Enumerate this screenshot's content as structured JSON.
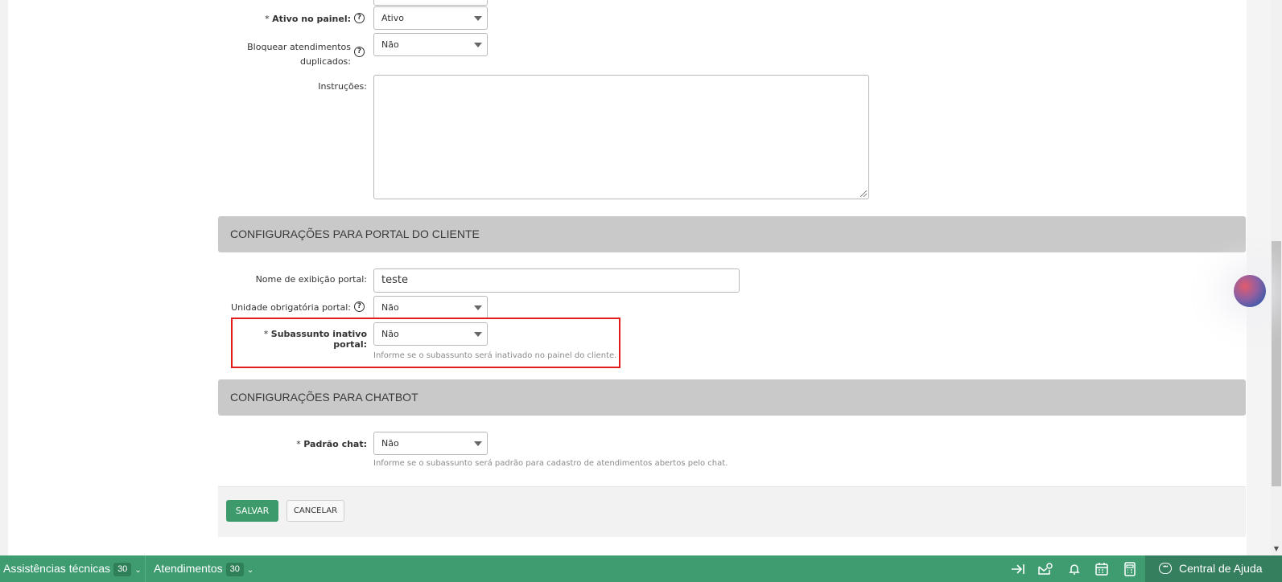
{
  "form": {
    "ativo_painel": {
      "label": "Ativo no painel:",
      "required_mark": "*",
      "value": "Ativo"
    },
    "bloquear": {
      "label_line1": "Bloquear atendimentos",
      "label_line2": "duplicados:",
      "value": "Não"
    },
    "instrucoes": {
      "label": "Instruções:",
      "value": ""
    }
  },
  "portal_section": {
    "title": "CONFIGURAÇÕES PARA PORTAL DO CLIENTE",
    "nome_exibicao": {
      "label": "Nome de exibição portal:",
      "value": "teste"
    },
    "unidade_obrigatoria": {
      "label": "Unidade obrigatória portal:",
      "value": "Não"
    },
    "subassunto_inativo": {
      "label": "Subassunto inativo portal:",
      "required_mark": "*",
      "value": "Não",
      "hint": "Informe se o subassunto será inativado no painel do cliente."
    }
  },
  "chatbot_section": {
    "title": "CONFIGURAÇÕES PARA CHATBOT",
    "padrao_chat": {
      "label": "Padrão chat:",
      "required_mark": "*",
      "value": "Não",
      "hint": "Informe se o subassunto será padrão para cadastro de atendimentos abertos pelo chat."
    }
  },
  "actions": {
    "save_label": "SALVAR",
    "cancel_label": "CANCELAR"
  },
  "help_glyph": "?",
  "bottom_bar": {
    "assistencias": {
      "label": "Assistências técnicas",
      "count": "30"
    },
    "atendimentos": {
      "label": "Atendimentos",
      "count": "30"
    },
    "help_center_label": "Central de Ajuda",
    "icons": [
      "arrow-to-right-icon",
      "mail-settings-icon",
      "bell-icon",
      "calendar-icon",
      "calculator-icon",
      "chat-bubble-icon"
    ]
  },
  "colors": {
    "accent_green": "#3e9c70",
    "save_button": "#3c9a6b",
    "highlight_red": "#e21b1b",
    "section_header": "#c9c9c9"
  }
}
